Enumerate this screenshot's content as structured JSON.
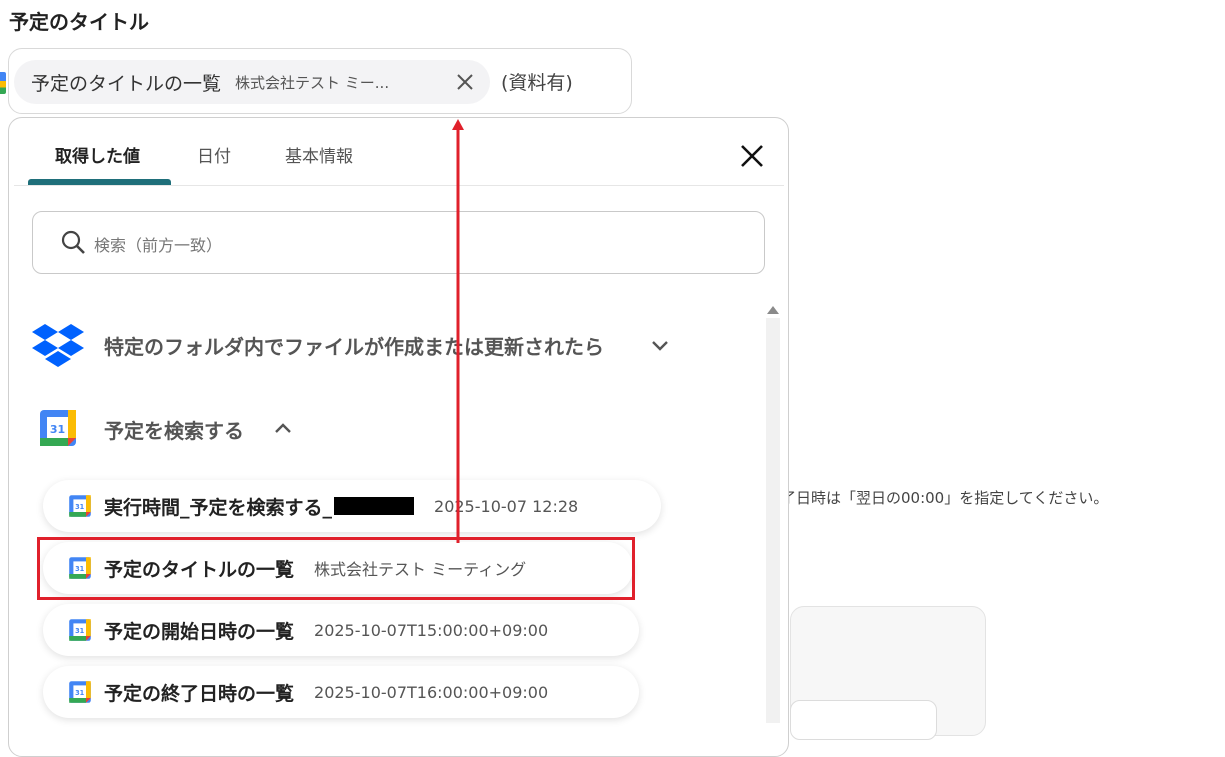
{
  "section_label": "予定のタイトル",
  "title_field": {
    "chip_label": "予定のタイトルの一覧",
    "chip_value": "株式会社テスト ミー...",
    "suffix": "(資料有)"
  },
  "background": {
    "hint_text": "了日時は「翌日の00:00」を指定してください。"
  },
  "panel": {
    "tabs": [
      {
        "label": "取得した値",
        "active": true
      },
      {
        "label": "日付",
        "active": false
      },
      {
        "label": "基本情報",
        "active": false
      }
    ],
    "search_placeholder": "検索（前方一致）",
    "groups": [
      {
        "icon": "dropbox-icon",
        "title": "特定のフォルダ内でファイルが作成または更新されたら",
        "expanded": false
      },
      {
        "icon": "google-calendar-icon",
        "title": "予定を検索する",
        "expanded": true
      }
    ],
    "items": [
      {
        "label": "実行時間_予定を検索する_",
        "value": "2025-10-07 12:28",
        "redacted": true
      },
      {
        "label": "予定のタイトルの一覧",
        "value": "株式会社テスト ミーティング",
        "highlighted": true
      },
      {
        "label": "予定の開始日時の一覧",
        "value": "2025-10-07T15:00:00+09:00"
      },
      {
        "label": "予定の終了日時の一覧",
        "value": "2025-10-07T16:00:00+09:00"
      }
    ]
  },
  "colors": {
    "tab_underline": "#1f6f7a",
    "highlight": "#e0202b",
    "dropbox": "#0061fe"
  }
}
